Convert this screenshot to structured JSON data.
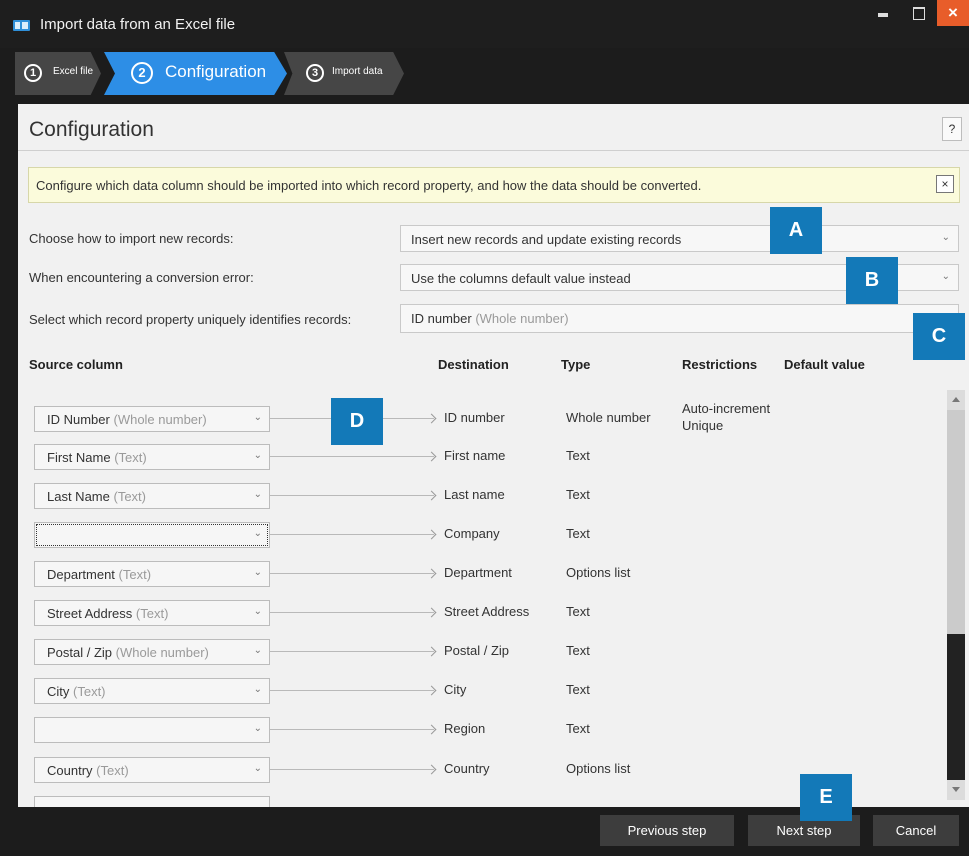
{
  "window": {
    "title": "Import data from an Excel file",
    "close_glyph": "×"
  },
  "steps": [
    {
      "number": "1",
      "label": "Excel file"
    },
    {
      "number": "2",
      "label": "Configuration"
    },
    {
      "number": "3",
      "label": "Import data"
    }
  ],
  "page": {
    "title": "Configuration",
    "help_label": "?"
  },
  "info": {
    "text": "Configure which data column should be imported into which record property, and how the data should be converted.",
    "close_glyph": "×"
  },
  "options": {
    "import_label": "Choose how to import new records:",
    "import_value": "Insert new records and update existing records",
    "error_label": "When encountering a conversion error:",
    "error_value": "Use the columns default value instead",
    "unique_label": "Select which record property uniquely identifies records:",
    "unique_value": "ID number",
    "unique_hint": "(Whole number)"
  },
  "columns": {
    "source": "Source column",
    "destination": "Destination",
    "type": "Type",
    "restrictions": "Restrictions",
    "default": "Default value"
  },
  "rows": [
    {
      "source": "ID Number",
      "hint": "(Whole number)",
      "destination": "ID number",
      "type": "Whole number",
      "restriction_1": "Auto-increment",
      "restriction_2": "Unique"
    },
    {
      "source": "First Name",
      "hint": "(Text)",
      "destination": "First name",
      "type": "Text"
    },
    {
      "source": "Last Name",
      "hint": "(Text)",
      "destination": "Last name",
      "type": "Text"
    },
    {
      "source": "",
      "hint": "",
      "destination": "Company",
      "type": "Text"
    },
    {
      "source": "Department",
      "hint": "(Text)",
      "destination": "Department",
      "type": "Options list"
    },
    {
      "source": "Street Address",
      "hint": "(Text)",
      "destination": "Street Address",
      "type": "Text"
    },
    {
      "source": "Postal / Zip",
      "hint": "(Whole number)",
      "destination": "Postal / Zip",
      "type": "Text"
    },
    {
      "source": "City",
      "hint": "(Text)",
      "destination": "City",
      "type": "Text"
    },
    {
      "source": "",
      "hint": "",
      "destination": "Region",
      "type": "Text"
    },
    {
      "source": "Country",
      "hint": "(Text)",
      "destination": "Country",
      "type": "Options list"
    }
  ],
  "markers": {
    "a": "A",
    "b": "B",
    "c": "C",
    "d": "D",
    "e": "E"
  },
  "footer": {
    "previous": "Previous step",
    "next": "Next step",
    "cancel": "Cancel"
  },
  "colors": {
    "accent": "#2d8ee6",
    "marker": "#1379b8",
    "close": "#e85d2a",
    "info_background": "#fbfbdb"
  },
  "icons": {
    "dropdown": "chevron-down-icon",
    "minimize": "minimize-icon",
    "maximize": "maximize-icon",
    "close": "close-icon",
    "app": "spreadsheet-icon"
  }
}
